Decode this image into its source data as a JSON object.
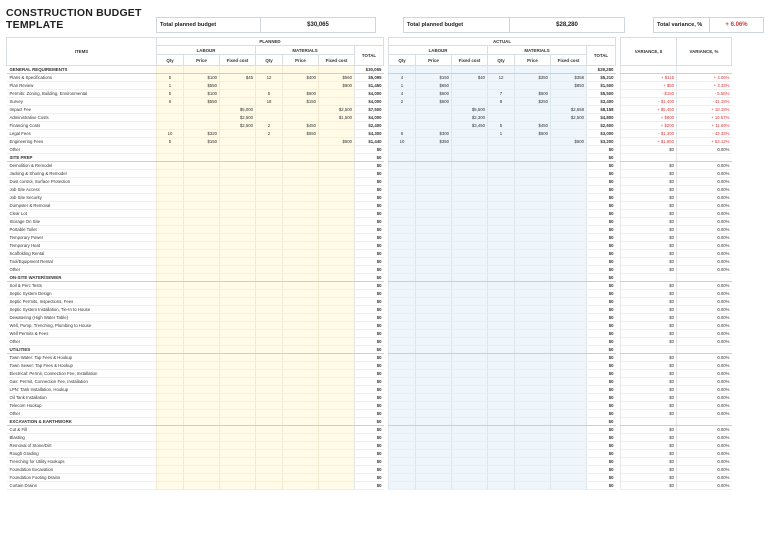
{
  "title": "CONSTRUCTION BUDGET TEMPLATE",
  "summary": {
    "planned_label": "Total planned budget",
    "planned_value": "$30,065",
    "actual_label": "Total planned budget",
    "actual_value": "$28,280",
    "variance_label": "Total variance, %",
    "variance_value": "+ 6.06%"
  },
  "headers": {
    "items": "ITEMS",
    "planned": "PLANNED",
    "actual": "ACTUAL",
    "labour": "LABOUR",
    "materials": "MATERIALS",
    "total": "TOTAL",
    "variance_usd": "VARIANCE, $",
    "variance_pct": "VARIANCE, %",
    "qty": "Qty",
    "price": "Price",
    "fixed_cost": "Fixed cost"
  },
  "sections": [
    {
      "name": "GENERAL REQUIREMENTS",
      "planned_total": "$30,065",
      "actual_total": "$28,280",
      "rows": [
        [
          "Plans & Specifications",
          "5",
          "$100",
          "$45",
          "12",
          "$400",
          "$560",
          "$5,095",
          "4",
          "$150",
          "$40",
          "12",
          "$350",
          "$358",
          "$5,210",
          "+ $115",
          "+ 4.06%"
        ],
        [
          "Plan Review",
          "1",
          "$550",
          "",
          "",
          "",
          "$900",
          "$1,450",
          "1",
          "$650",
          "",
          "",
          "",
          "$850",
          "$1,500",
          "+ $50",
          "+ 3.33%"
        ],
        [
          "Permits: Zoning, Building, Environmental",
          "5",
          "$100",
          "",
          "5",
          "$600",
          "",
          "$4,000",
          "4",
          "$600",
          "",
          "7",
          "$500",
          "",
          "$5,500",
          "- $150",
          "- 5.56%"
        ],
        [
          "Survey",
          "6",
          "$550",
          "",
          "18",
          "$150",
          "",
          "$4,000",
          "2",
          "$600",
          "",
          "8",
          "$250",
          "",
          "$3,400",
          "- $1,400",
          "- 41.18%"
        ],
        [
          "Impact Fee",
          "",
          "",
          "$5,000",
          "",
          "",
          "$2,500",
          "$7,500",
          "",
          "",
          "$5,500",
          "",
          "",
          "$2,658",
          "$8,158",
          "+ $5,450",
          "+ 18.18%"
        ],
        [
          "Administrative Costs",
          "",
          "",
          "$2,500",
          "",
          "",
          "$1,500",
          "$4,000",
          "",
          "",
          "$2,300",
          "",
          "",
          "$2,500",
          "$4,800",
          "+ $800",
          "+ 16.67%"
        ],
        [
          "Financing Costs",
          "",
          "",
          "$2,500",
          "2",
          "$450",
          "",
          "$2,400",
          "",
          "",
          "$3,450",
          "5",
          "$450",
          "",
          "$2,600",
          "+ $200",
          "+ 11.69%"
        ],
        [
          "Legal Fees",
          "10",
          "$320",
          "",
          "2",
          "$550",
          "",
          "$4,300",
          "6",
          "$300",
          "",
          "1",
          "$500",
          "",
          "$3,000",
          "- $1,300",
          "- 43.33%"
        ],
        [
          "Engineering Fees",
          "5",
          "$150",
          "",
          "",
          "",
          "$500",
          "$1,440",
          "10",
          "$350",
          "",
          "",
          "",
          "$600",
          "$3,200",
          "+ $1,860",
          "+ 53.12%"
        ],
        [
          "Other",
          "",
          "",
          "",
          "",
          "",
          "",
          "$0",
          "",
          "",
          "",
          "",
          "",
          "",
          "$0",
          "$0",
          "0.00%"
        ]
      ]
    },
    {
      "name": "SITE PREP",
      "planned_total": "$0",
      "actual_total": "$0",
      "items": [
        "Demolition & Remodel",
        "Jacking & Shoring & Remodel",
        "Dust control, Surface Protection",
        "Job Site Access",
        "Job Site Security",
        "Dumpster & Removal",
        "Clear Lot",
        "Storage On Site",
        "Portable Toilet",
        "Temporary Power",
        "Temporary Heat",
        "Scaffolding Rental",
        "Tool/Equipment Rental",
        "Other"
      ]
    },
    {
      "name": "ON-SITE WATER/SEWER",
      "planned_total": "$0",
      "actual_total": "$0",
      "items": [
        "Soil & Perc Tests",
        "Septic System Design",
        "Septic Permits, Inspections, Fees",
        "Septic System Installation, Tie-In to House",
        "Dewatering (High Water Table)",
        "Well, Pump, Trenching, Plumbing to House",
        "Well Permits & Fees",
        "Other"
      ]
    },
    {
      "name": "UTILITIES",
      "planned_total": "$0",
      "actual_total": "$0",
      "items": [
        "Town Water: Tap Fees & Hookup",
        "Town Sewer: Tap Fees & Hookup",
        "Electrical: Permit, Connection Fee, Installation",
        "Gas: Permit, Connection Fee, Installation",
        "LPN: Tank Installation, Hookup",
        "Oil Tank Installation",
        "Telecom Hookup",
        "Other"
      ]
    },
    {
      "name": "EXCAVATION & EARTHWORK",
      "planned_total": "$0",
      "actual_total": "$0",
      "items": [
        "Cut & Fill",
        "Blasting",
        "Removal of Stone/Dirt",
        "Rough Grading",
        "Trenching for Utility Hookups",
        "Foundation Excavation",
        "Foundation Footing Drains",
        "Curtain Drains"
      ]
    }
  ],
  "empty_values": {
    "total": "$0",
    "variance_usd": "$0",
    "variance_pct": "0.00%"
  }
}
